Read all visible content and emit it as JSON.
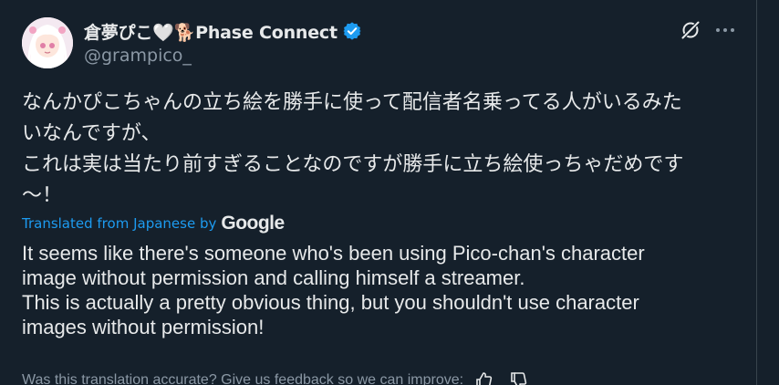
{
  "author": {
    "display_name": "倉夢ぴこ🤍🐕Phase Connect",
    "handle": "@grampico_",
    "verified_icon": "verified-badge-icon",
    "avatar_icon": "avatar-image"
  },
  "header_actions": {
    "grok_icon": "grok-icon",
    "more_icon": "more-options-icon"
  },
  "post": {
    "original_lines": [
      "なんかぴこちゃんの立ち絵を勝手に使って配信者名乗ってる人がいるみた",
      "いなんですが、",
      "これは実は当たり前すぎることなのですが勝手に立ち絵使っちゃだめです",
      "〜！"
    ]
  },
  "translation": {
    "label": "Translated from Japanese by",
    "provider": "Google",
    "lines": [
      "It seems like there's someone who's been using Pico-chan's character",
      "image without permission and calling himself a streamer.",
      "This is actually a pretty obvious thing, but you shouldn't use character",
      "images without permission!"
    ],
    "feedback_prompt": "Was this translation accurate? Give us feedback so we can improve:",
    "feedback_icons": [
      "thumbs-up-icon",
      "thumbs-down-icon"
    ]
  },
  "colors": {
    "background": "#15202b",
    "text": "#e7e9ea",
    "muted": "#8b98a5",
    "accent": "#1d9bf0"
  }
}
